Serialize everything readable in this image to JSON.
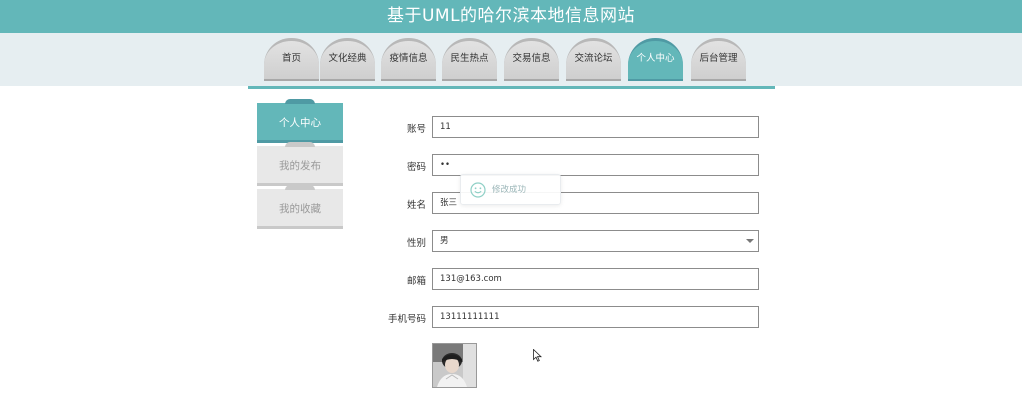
{
  "header": {
    "title": "基于UML的哈尔滨本地信息网站"
  },
  "nav": {
    "items": [
      {
        "label": "首页"
      },
      {
        "label": "文化经典"
      },
      {
        "label": "疫情信息"
      },
      {
        "label": "民生热点"
      },
      {
        "label": "交易信息"
      },
      {
        "label": "交流论坛"
      },
      {
        "label": "个人中心",
        "active": true
      },
      {
        "label": "后台管理"
      }
    ]
  },
  "sidebar": {
    "items": [
      {
        "label": "个人中心",
        "active": true
      },
      {
        "label": "我的发布"
      },
      {
        "label": "我的收藏"
      }
    ]
  },
  "form": {
    "account": {
      "label": "账号",
      "value": "11"
    },
    "password": {
      "label": "密码",
      "value": "••"
    },
    "name": {
      "label": "姓名",
      "value": "张三"
    },
    "gender": {
      "label": "性别",
      "value": "男"
    },
    "email": {
      "label": "邮箱",
      "value": "131@163.com"
    },
    "phone": {
      "label": "手机号码",
      "value": "13111111111"
    }
  },
  "toast": {
    "message": "修改成功"
  },
  "colors": {
    "accent": "#63b7b9",
    "accent_dark": "#4f9aa4",
    "nav_band": "#e6eef1",
    "tab_inactive": "#d8d8d8"
  },
  "icons": {
    "toast": "smile-icon",
    "select": "chevron-down-icon",
    "cursor": "mouse-pointer-icon"
  }
}
